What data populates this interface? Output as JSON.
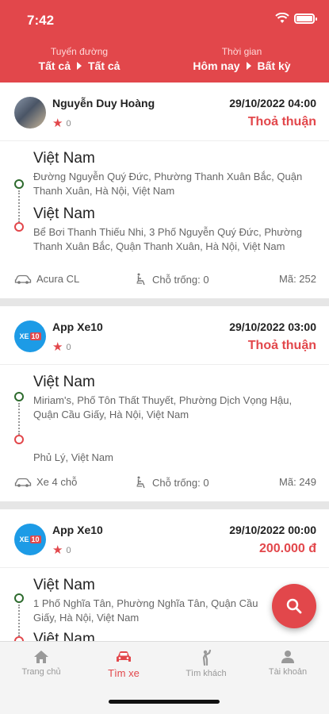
{
  "status": {
    "time": "7:42"
  },
  "filters": {
    "route": {
      "label": "Tuyến đường",
      "from": "Tất cả",
      "to": "Tất cả"
    },
    "time": {
      "label": "Thời gian",
      "from": "Hôm nay",
      "to": "Bất kỳ"
    }
  },
  "trips": [
    {
      "driver": "Nguyễn Duy Hoàng",
      "rating": "0",
      "datetime": "29/10/2022 04:00",
      "price": "Thoả thuận",
      "origin_title": "Việt Nam",
      "origin_addr": "Đường Nguyễn Quý Đức, Phường Thanh Xuân Bắc, Quận Thanh Xuân, Hà Nội, Việt Nam",
      "dest_title": "Việt Nam",
      "dest_addr": "Bể Bơi Thanh Thiếu Nhi, 3 Phố Nguyễn Quý Đức, Phường Thanh Xuân Bắc, Quận Thanh Xuân, Hà Nội, Việt Nam",
      "vehicle": "Acura CL",
      "seats": "Chỗ trống: 0",
      "code": "Mã: 252"
    },
    {
      "driver": "App Xe10",
      "rating": "0",
      "datetime": "29/10/2022 03:00",
      "price": "Thoả thuận",
      "origin_title": "Việt Nam",
      "origin_addr": "Miriam's, Phố Tôn Thất Thuyết, Phường Dịch Vọng Hậu, Quận Cầu Giấy, Hà Nội, Việt Nam",
      "dest_addr": "Phủ Lý, Việt Nam",
      "vehicle": "Xe 4 chỗ",
      "seats": "Chỗ trống: 0",
      "code": "Mã: 249"
    },
    {
      "driver": "App Xe10",
      "rating": "0",
      "datetime": "29/10/2022 00:00",
      "price": "200.000 đ",
      "origin_title": "Việt Nam",
      "origin_addr": "1 Phố Nghĩa Tân, Phường Nghĩa Tân, Quận Cầu Giấy, Hà Nội, Việt Nam",
      "dest_title": "Việt Nam"
    }
  ],
  "logo_text": {
    "part1": "XE",
    "part2": "10"
  },
  "nav": [
    {
      "label": "Trang chủ",
      "icon": "home-icon"
    },
    {
      "label": "Tìm xe",
      "icon": "car-icon"
    },
    {
      "label": "Tìm khách",
      "icon": "hail-icon"
    },
    {
      "label": "Tài khoản",
      "icon": "person-icon"
    }
  ],
  "colors": {
    "brand": "#e2474b",
    "origin_dot": "#2e6b2e"
  }
}
